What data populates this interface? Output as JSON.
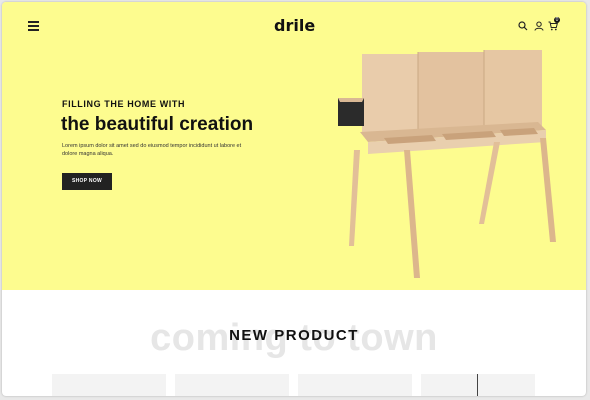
{
  "header": {
    "logo": "drile",
    "menu_icon": "hamburger-menu-icon",
    "search_icon": "search-icon",
    "account_icon": "user-icon",
    "cart_icon": "cart-icon",
    "cart_count": "0"
  },
  "hero": {
    "kicker": "FILLING THE HOME WITH",
    "headline": "the beautiful creation",
    "description": "Lorem ipsum dolor sit amet sed do eiusmod tempor incididunt ut labore et dolore magna aliqua.",
    "button_label": "SHOP NOW",
    "background_color": "#fdfc8f",
    "image": "wooden-desk-with-raised-lid"
  },
  "new_products": {
    "background_text": "coming to town",
    "title": "NEW PRODUCT",
    "card_count_visible": "4"
  }
}
